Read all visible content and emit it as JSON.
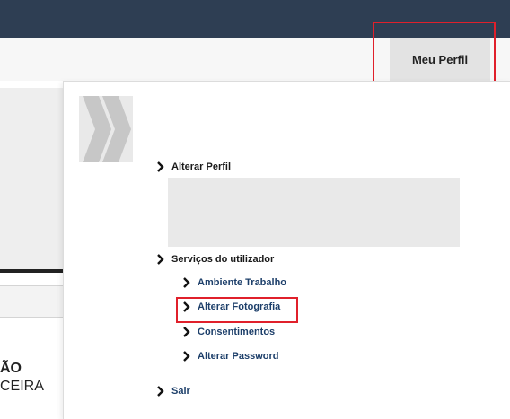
{
  "header": {
    "profile_label": "Meu Perfil"
  },
  "background_page": {
    "text_line1": "ÃO",
    "text_line2": "CEIRA"
  },
  "menu": {
    "alterar_perfil": "Alterar Perfil",
    "servicos": "Serviços do utilizador",
    "sub_items": [
      "Ambiente Trabalho",
      "Alterar Fotografia",
      "Consentimentos",
      "Alterar Password"
    ],
    "sair": "Sair"
  },
  "colors": {
    "topbar": "#2e3e53",
    "highlight": "#e0202b",
    "sub_link": "#1d3f6a"
  },
  "icons": {
    "menu_bullet": "chevron-right-icon",
    "logo": "double-chevron-logo"
  }
}
